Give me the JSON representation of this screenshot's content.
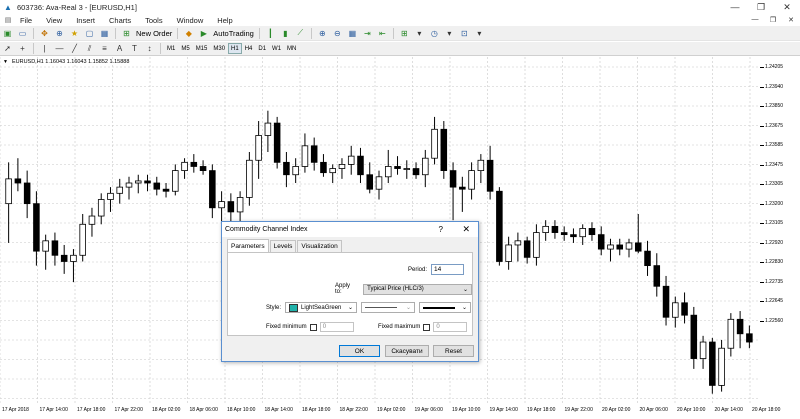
{
  "window": {
    "title": "603736: Ava-Real 3 - [EURUSD,H1]",
    "controls": [
      "—",
      "❐",
      "✕"
    ]
  },
  "menu": {
    "items": [
      "File",
      "View",
      "Insert",
      "Charts",
      "Tools",
      "Window",
      "Help"
    ],
    "mdi_controls": [
      "—",
      "❐",
      "✕"
    ]
  },
  "toolbar": {
    "new_order": "New Order",
    "autotrading": "AutoTrading",
    "timeframes": [
      "M1",
      "M5",
      "M15",
      "M30",
      "H1",
      "H4",
      "D1",
      "W1",
      "MN"
    ],
    "active_timeframe": "H1"
  },
  "chart": {
    "symbol_info": "EURUSD,H1  1.16043 1.16043 1.15852 1.15888",
    "y_labels": [
      "1.24205",
      "1.23940",
      "1.23850",
      "1.23675",
      "1.23585",
      "1.23475",
      "1.23305",
      "1.23200",
      "1.23105",
      "1.22920",
      "1.22830",
      "1.22735",
      "1.22645",
      "1.22560"
    ],
    "x_labels": [
      "17 Apr 2018",
      "17 Apr 14:00",
      "17 Apr 18:00",
      "17 Apr 22:00",
      "18 Apr 02:00",
      "18 Apr 06:00",
      "18 Apr 10:00",
      "18 Apr 14:00",
      "18 Apr 18:00",
      "18 Apr 22:00",
      "19 Apr 02:00",
      "19 Apr 06:00",
      "19 Apr 10:00",
      "19 Apr 14:00",
      "19 Apr 18:00",
      "19 Apr 22:00",
      "20 Apr 02:00",
      "20 Apr 06:00",
      "20 Apr 10:00",
      "20 Apr 14:00",
      "20 Apr 18:00"
    ],
    "candles": [
      {
        "o": 1.235,
        "h": 1.237,
        "l": 1.2331,
        "c": 1.2362
      },
      {
        "o": 1.2362,
        "h": 1.2372,
        "l": 1.2356,
        "c": 1.236
      },
      {
        "o": 1.236,
        "h": 1.2366,
        "l": 1.2343,
        "c": 1.235
      },
      {
        "o": 1.235,
        "h": 1.2356,
        "l": 1.232,
        "c": 1.2327
      },
      {
        "o": 1.2327,
        "h": 1.2335,
        "l": 1.2318,
        "c": 1.2332
      },
      {
        "o": 1.2332,
        "h": 1.2336,
        "l": 1.232,
        "c": 1.2325
      },
      {
        "o": 1.2325,
        "h": 1.233,
        "l": 1.2316,
        "c": 1.2322
      },
      {
        "o": 1.2322,
        "h": 1.2328,
        "l": 1.2312,
        "c": 1.2325
      },
      {
        "o": 1.2325,
        "h": 1.2345,
        "l": 1.2322,
        "c": 1.234
      },
      {
        "o": 1.234,
        "h": 1.2348,
        "l": 1.2334,
        "c": 1.2344
      },
      {
        "o": 1.2344,
        "h": 1.2355,
        "l": 1.234,
        "c": 1.2352
      },
      {
        "o": 1.2352,
        "h": 1.2358,
        "l": 1.2346,
        "c": 1.2355
      },
      {
        "o": 1.2355,
        "h": 1.2362,
        "l": 1.235,
        "c": 1.2358
      },
      {
        "o": 1.2358,
        "h": 1.2363,
        "l": 1.2352,
        "c": 1.236
      },
      {
        "o": 1.236,
        "h": 1.2364,
        "l": 1.2355,
        "c": 1.2361
      },
      {
        "o": 1.2361,
        "h": 1.2364,
        "l": 1.2356,
        "c": 1.236
      },
      {
        "o": 1.236,
        "h": 1.2363,
        "l": 1.2354,
        "c": 1.2357
      },
      {
        "o": 1.2357,
        "h": 1.236,
        "l": 1.2353,
        "c": 1.2356
      },
      {
        "o": 1.2356,
        "h": 1.2369,
        "l": 1.2354,
        "c": 1.2366
      },
      {
        "o": 1.2366,
        "h": 1.2372,
        "l": 1.2362,
        "c": 1.237
      },
      {
        "o": 1.237,
        "h": 1.2374,
        "l": 1.2365,
        "c": 1.2368
      },
      {
        "o": 1.2368,
        "h": 1.2371,
        "l": 1.2364,
        "c": 1.2366
      },
      {
        "o": 1.2366,
        "h": 1.2369,
        "l": 1.2343,
        "c": 1.2348
      },
      {
        "o": 1.2348,
        "h": 1.2356,
        "l": 1.234,
        "c": 1.2351
      },
      {
        "o": 1.2351,
        "h": 1.2355,
        "l": 1.232,
        "c": 1.2346
      },
      {
        "o": 1.2346,
        "h": 1.2356,
        "l": 1.2334,
        "c": 1.2353
      },
      {
        "o": 1.2353,
        "h": 1.2375,
        "l": 1.2349,
        "c": 1.2371
      },
      {
        "o": 1.2371,
        "h": 1.239,
        "l": 1.2362,
        "c": 1.2383
      },
      {
        "o": 1.2383,
        "h": 1.2395,
        "l": 1.2375,
        "c": 1.2389
      },
      {
        "o": 1.2389,
        "h": 1.2392,
        "l": 1.2367,
        "c": 1.237
      },
      {
        "o": 1.237,
        "h": 1.2375,
        "l": 1.2358,
        "c": 1.2364
      },
      {
        "o": 1.2364,
        "h": 1.2372,
        "l": 1.236,
        "c": 1.2368
      },
      {
        "o": 1.2368,
        "h": 1.2384,
        "l": 1.2365,
        "c": 1.2378
      },
      {
        "o": 1.2378,
        "h": 1.2382,
        "l": 1.2366,
        "c": 1.237
      },
      {
        "o": 1.237,
        "h": 1.2374,
        "l": 1.2363,
        "c": 1.2365
      },
      {
        "o": 1.2365,
        "h": 1.2369,
        "l": 1.236,
        "c": 1.2367
      },
      {
        "o": 1.2367,
        "h": 1.2372,
        "l": 1.2362,
        "c": 1.2369
      },
      {
        "o": 1.2369,
        "h": 1.2378,
        "l": 1.2364,
        "c": 1.2373
      },
      {
        "o": 1.2373,
        "h": 1.2377,
        "l": 1.236,
        "c": 1.2364
      },
      {
        "o": 1.2364,
        "h": 1.237,
        "l": 1.2355,
        "c": 1.2357
      },
      {
        "o": 1.2357,
        "h": 1.2366,
        "l": 1.2352,
        "c": 1.2363
      },
      {
        "o": 1.2363,
        "h": 1.2376,
        "l": 1.236,
        "c": 1.2368
      },
      {
        "o": 1.2368,
        "h": 1.2373,
        "l": 1.2364,
        "c": 1.2367
      },
      {
        "o": 1.2367,
        "h": 1.2371,
        "l": 1.2362,
        "c": 1.2367
      },
      {
        "o": 1.2367,
        "h": 1.237,
        "l": 1.2362,
        "c": 1.2364
      },
      {
        "o": 1.2364,
        "h": 1.2376,
        "l": 1.2358,
        "c": 1.2372
      },
      {
        "o": 1.2372,
        "h": 1.2392,
        "l": 1.2369,
        "c": 1.2386
      },
      {
        "o": 1.2386,
        "h": 1.239,
        "l": 1.2362,
        "c": 1.2366
      },
      {
        "o": 1.2366,
        "h": 1.237,
        "l": 1.2342,
        "c": 1.2358
      },
      {
        "o": 1.2358,
        "h": 1.2363,
        "l": 1.2346,
        "c": 1.2357
      },
      {
        "o": 1.2357,
        "h": 1.237,
        "l": 1.2352,
        "c": 1.2366
      },
      {
        "o": 1.2366,
        "h": 1.2374,
        "l": 1.236,
        "c": 1.2371
      },
      {
        "o": 1.2371,
        "h": 1.2378,
        "l": 1.2352,
        "c": 1.2356
      },
      {
        "o": 1.2356,
        "h": 1.2358,
        "l": 1.232,
        "c": 1.2322
      },
      {
        "o": 1.2322,
        "h": 1.2334,
        "l": 1.2318,
        "c": 1.233
      },
      {
        "o": 1.233,
        "h": 1.2336,
        "l": 1.2322,
        "c": 1.2332
      },
      {
        "o": 1.2332,
        "h": 1.2334,
        "l": 1.2321,
        "c": 1.2324
      },
      {
        "o": 1.2324,
        "h": 1.234,
        "l": 1.232,
        "c": 1.2336
      },
      {
        "o": 1.2336,
        "h": 1.2342,
        "l": 1.2332,
        "c": 1.2339
      },
      {
        "o": 1.2339,
        "h": 1.2342,
        "l": 1.2333,
        "c": 1.2336
      },
      {
        "o": 1.2336,
        "h": 1.2339,
        "l": 1.2332,
        "c": 1.2335
      },
      {
        "o": 1.2335,
        "h": 1.2338,
        "l": 1.2331,
        "c": 1.2334
      },
      {
        "o": 1.2334,
        "h": 1.234,
        "l": 1.233,
        "c": 1.2338
      },
      {
        "o": 1.2338,
        "h": 1.2341,
        "l": 1.2332,
        "c": 1.2335
      },
      {
        "o": 1.2335,
        "h": 1.2339,
        "l": 1.2325,
        "c": 1.2328
      },
      {
        "o": 1.2328,
        "h": 1.2333,
        "l": 1.2322,
        "c": 1.233
      },
      {
        "o": 1.233,
        "h": 1.2333,
        "l": 1.2325,
        "c": 1.2328
      },
      {
        "o": 1.2328,
        "h": 1.2333,
        "l": 1.2324,
        "c": 1.2331
      },
      {
        "o": 1.2331,
        "h": 1.2345,
        "l": 1.2326,
        "c": 1.2327
      },
      {
        "o": 1.2327,
        "h": 1.2332,
        "l": 1.2315,
        "c": 1.232
      },
      {
        "o": 1.232,
        "h": 1.2326,
        "l": 1.2305,
        "c": 1.231
      },
      {
        "o": 1.231,
        "h": 1.2315,
        "l": 1.2291,
        "c": 1.2295
      },
      {
        "o": 1.2295,
        "h": 1.2305,
        "l": 1.229,
        "c": 1.2302
      },
      {
        "o": 1.2302,
        "h": 1.2307,
        "l": 1.2292,
        "c": 1.2296
      },
      {
        "o": 1.2296,
        "h": 1.23,
        "l": 1.227,
        "c": 1.2275
      },
      {
        "o": 1.2275,
        "h": 1.2286,
        "l": 1.227,
        "c": 1.2283
      },
      {
        "o": 1.2283,
        "h": 1.2285,
        "l": 1.2258,
        "c": 1.2262
      },
      {
        "o": 1.2262,
        "h": 1.2284,
        "l": 1.2259,
        "c": 1.228
      },
      {
        "o": 1.228,
        "h": 1.2297,
        "l": 1.2276,
        "c": 1.2294
      },
      {
        "o": 1.2294,
        "h": 1.2298,
        "l": 1.228,
        "c": 1.2287
      },
      {
        "o": 1.2287,
        "h": 1.2291,
        "l": 1.228,
        "c": 1.2283
      }
    ]
  },
  "dialog": {
    "title": "Commodity Channel Index",
    "help": "?",
    "close": "✕",
    "tabs": [
      "Parameters",
      "Levels",
      "Visualization"
    ],
    "period_label": "Period:",
    "period_value": "14",
    "apply_label": "Apply to:",
    "apply_value": "Typical Price (HLC/3)",
    "style_label": "Style:",
    "style_color_name": "LightSeaGreen",
    "style_color": "#20b2aa",
    "fixed_min_label": "Fixed minimum",
    "fixed_min_value": "0",
    "fixed_max_label": "Fixed maximum",
    "fixed_max_value": "0",
    "ok": "OK",
    "cancel": "Скасувати",
    "reset": "Reset"
  }
}
